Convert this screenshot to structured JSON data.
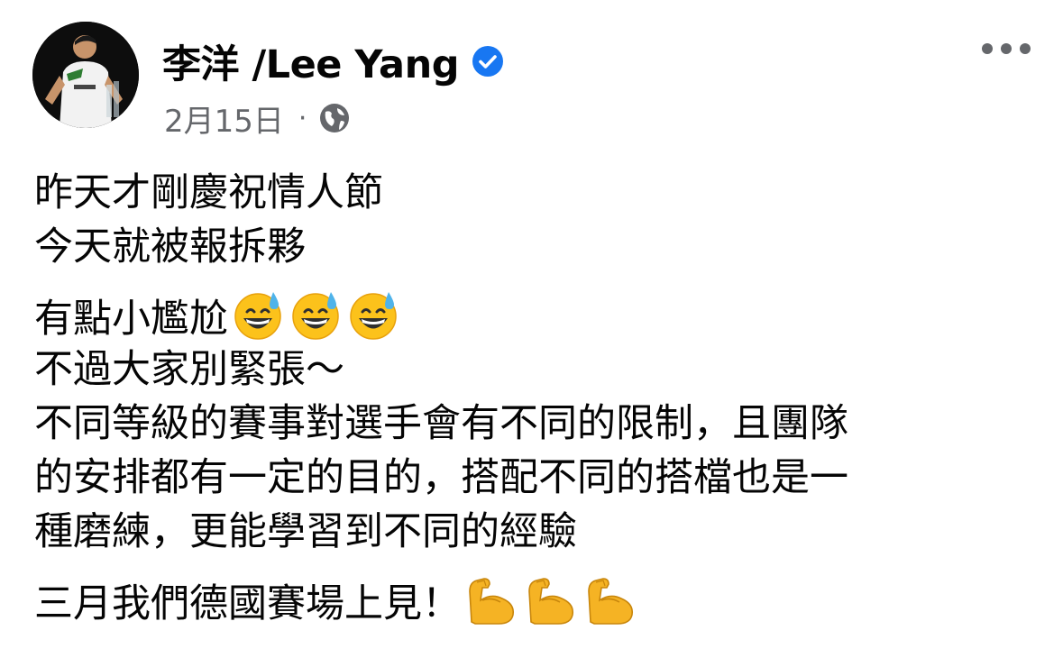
{
  "author": {
    "name": "李洋 /Lee Yang",
    "verified": true,
    "verified_color": "#1877f2"
  },
  "meta": {
    "date": "2月15日",
    "separator": "·",
    "audience_icon": "globe-icon"
  },
  "menu": {
    "more_icon": "more-horizontal-icon"
  },
  "post_text": {
    "line1": "昨天才剛慶祝情人節",
    "line2": "今天就被報拆夥",
    "line3": "有點小尷尬",
    "line3_emoji": "grinning-face-with-sweat-emoji",
    "line4": "不過大家別緊張～",
    "line5": "不同等級的賽事對選手會有不同的限制，且團隊",
    "line6": "的安排都有一定的目的，搭配不同的搭檔也是一",
    "line7": "種磨練，更能學習到不同的經驗",
    "line8": "三月我們德國賽場上見！",
    "line8_emoji": "flexed-biceps-emoji"
  }
}
